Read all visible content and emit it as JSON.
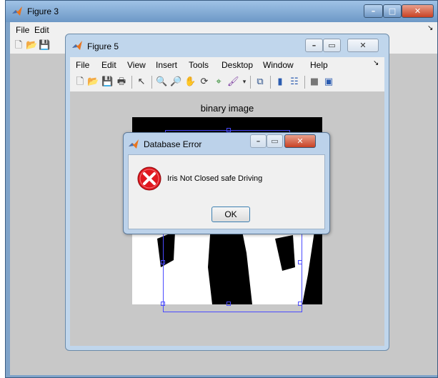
{
  "figure3": {
    "title": "Figure 3",
    "menu": [
      "File",
      "Edit"
    ]
  },
  "figure5": {
    "title": "Figure 5",
    "menu": [
      "File",
      "Edit",
      "View",
      "Insert",
      "Tools",
      "Desktop",
      "Window",
      "Help"
    ],
    "axes_title": "binary image"
  },
  "dialog": {
    "title": "Database Error",
    "message": "Iris Not Closed safe Driving",
    "ok_label": "OK"
  },
  "icons": {
    "app": "matlab-logo-icon",
    "error": "error-x-icon"
  },
  "colors": {
    "titlebar": "#7fa3c9",
    "close_red": "#c84224",
    "error_red": "#e0181f",
    "selection": "#4a4aff"
  }
}
